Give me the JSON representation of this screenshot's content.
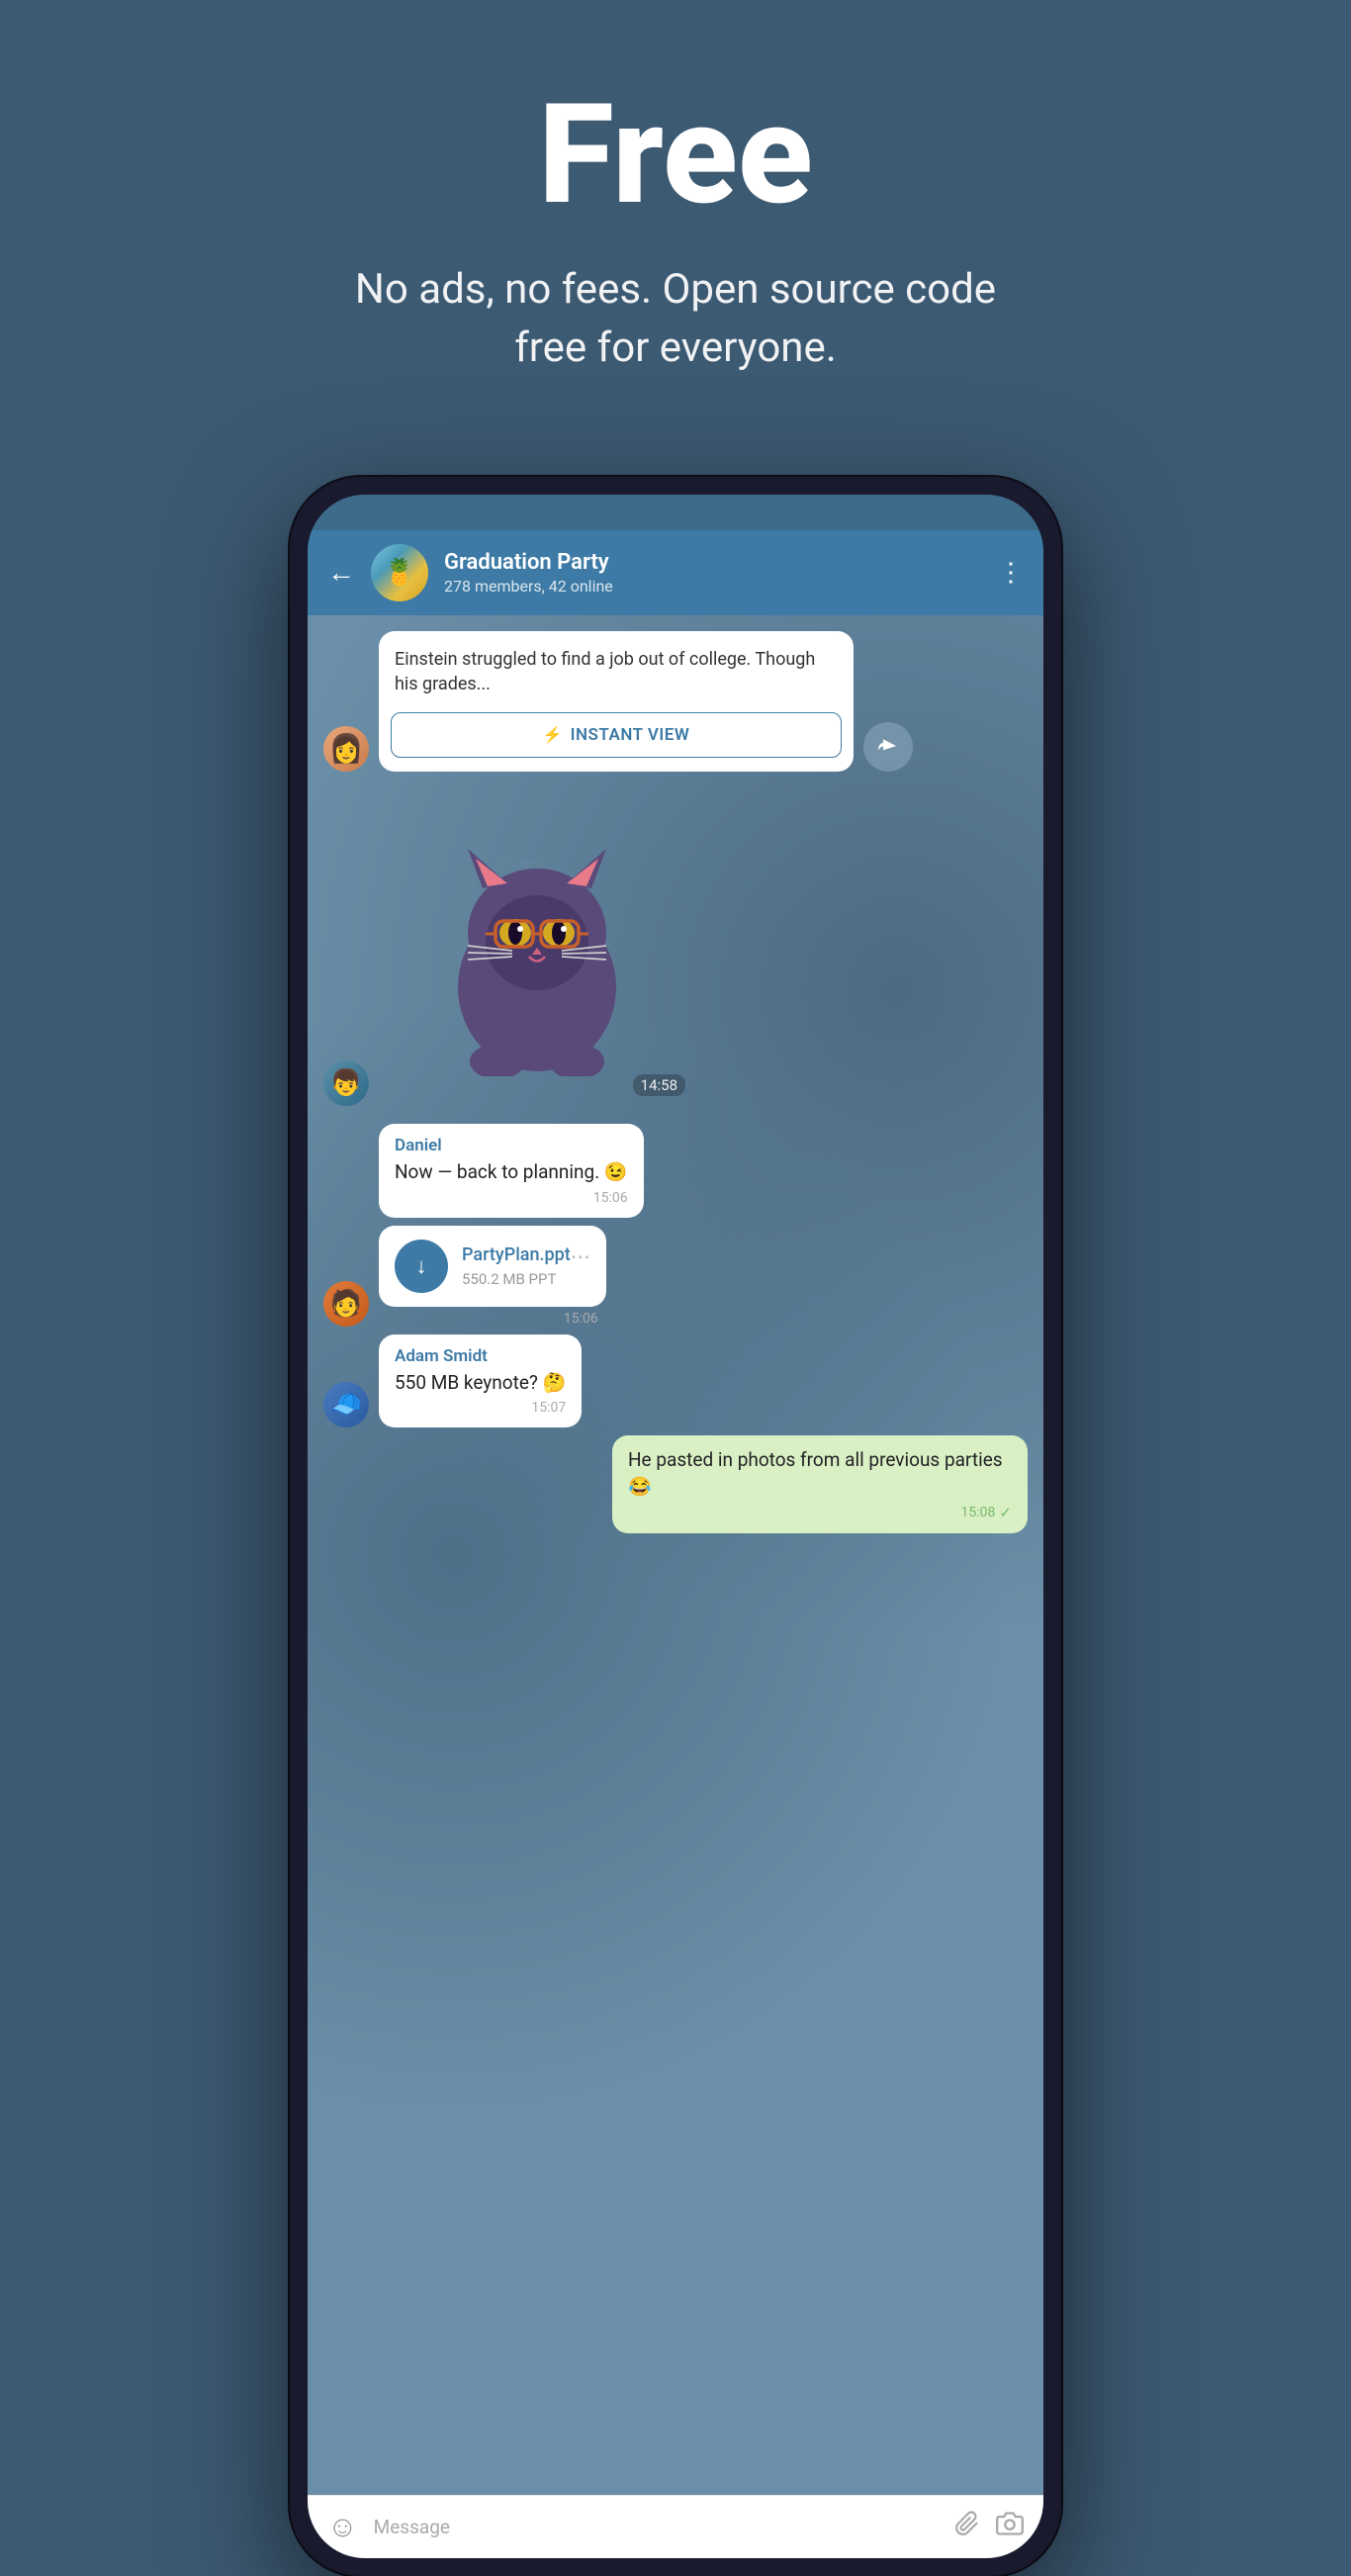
{
  "hero": {
    "title": "Free",
    "subtitle": "No ads, no fees. Open source code free for everyone."
  },
  "header": {
    "back_label": "←",
    "chat_name": "Graduation Party",
    "chat_meta": "278 members, 42 online",
    "more_icon": "⋮"
  },
  "messages": {
    "article": {
      "text": "Einstein struggled to find a job out of college. Though his grades...",
      "instant_view_label": "INSTANT VIEW"
    },
    "sticker_time": "14:58",
    "daniel": {
      "sender": "Daniel",
      "text": "Now — back to planning. 😉",
      "time": "15:06"
    },
    "file": {
      "name": "PartyPlan.ppt",
      "size": "550.2 MB PPT",
      "time": "15:06"
    },
    "adam": {
      "sender": "Adam Smidt",
      "text": "550 MB keynote? 🤔",
      "time": "15:07"
    },
    "outgoing": {
      "text": "He pasted in photos from all previous parties 😂",
      "time": "15:08"
    }
  },
  "input_bar": {
    "placeholder": "Message"
  }
}
